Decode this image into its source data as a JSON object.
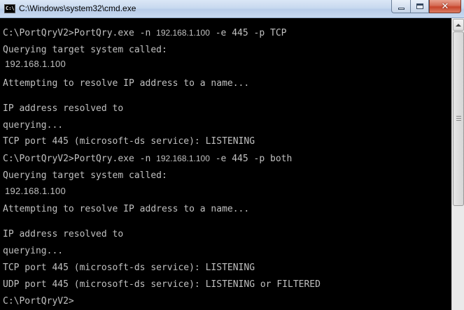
{
  "window": {
    "title": "C:\\Windows\\system32\\cmd.exe",
    "icon_label": "C:\\",
    "icon": "cmd-icon",
    "buttons": {
      "minimize": "minimize-icon",
      "maximize": "maximize-icon",
      "close": "close-icon"
    },
    "close_glyph": "✕"
  },
  "console": {
    "colors": {
      "background": "#000000",
      "foreground": "#c0c0c0"
    },
    "lines": [
      {
        "pre": "C:\\PortQryV2>PortQry.exe -n ",
        "ip": "192.168.1.100",
        "post": " -e 445 -p TCP"
      },
      {
        "text": "Querying target system called:"
      },
      {
        "ip": "192.168.1.100"
      },
      {
        "text": "Attempting to resolve IP address to a name..."
      },
      {
        "text": "IP address resolved to"
      },
      {
        "text": "querying..."
      },
      {
        "text": "TCP port 445 (microsoft-ds service): LISTENING"
      },
      {
        "pre": "C:\\PortQryV2>PortQry.exe -n ",
        "ip": "192.168.1.100",
        "post": " -e 445 -p both"
      },
      {
        "text": "Querying target system called:"
      },
      {
        "ip": "192.168.1.100"
      },
      {
        "text": "Attempting to resolve IP address to a name..."
      },
      {
        "text": "IP address resolved to"
      },
      {
        "text": "querying..."
      },
      {
        "text": "TCP port 445 (microsoft-ds service): LISTENING"
      },
      {
        "text": "UDP port 445 (microsoft-ds service): LISTENING or FILTERED"
      },
      {
        "text": "C:\\PortQryV2>"
      }
    ]
  }
}
